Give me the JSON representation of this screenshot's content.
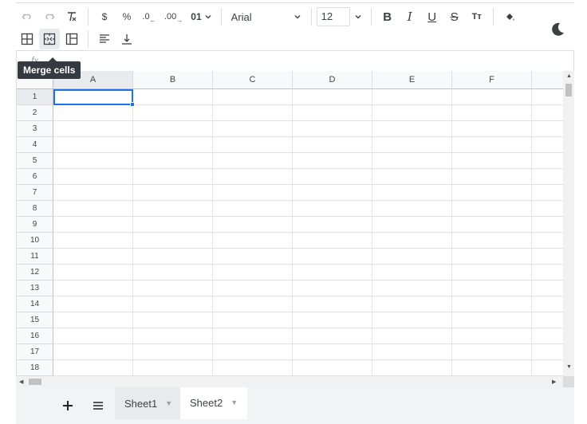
{
  "toolbar": {
    "currency_label": "$",
    "percent_label": "%",
    "decrease_decimal_label": ".0",
    "increase_decimal_label": ".00",
    "number_format_label": "01",
    "font_name": "Arial",
    "font_size": "12",
    "bold_label": "B",
    "italic_label": "I",
    "underline_label": "U",
    "strike_label": "S",
    "text_size_label": "Tт"
  },
  "formula_bar": {
    "fx_label": "fx"
  },
  "tooltip": {
    "text": "Merge cells"
  },
  "grid": {
    "columns": [
      "A",
      "B",
      "C",
      "D",
      "E",
      "F"
    ],
    "rows": [
      "1",
      "2",
      "3",
      "4",
      "5",
      "6",
      "7",
      "8",
      "9",
      "10",
      "11",
      "12",
      "13",
      "14",
      "15",
      "16",
      "17",
      "18"
    ],
    "active_cell": "A1"
  },
  "sheets": [
    {
      "label": "Sheet1"
    },
    {
      "label": "Sheet2"
    }
  ],
  "colors": {
    "accent": "#1a73e8",
    "tooltip_bg": "#353a40"
  }
}
